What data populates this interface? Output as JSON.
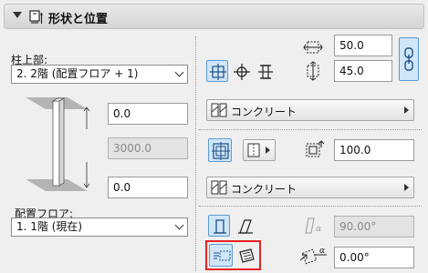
{
  "header": {
    "title": "形状と位置"
  },
  "left": {
    "top_label": "柱上部:",
    "top_select": "2. 2階 (配置フロア + 1)",
    "top_offset": "0.0",
    "height": "3000.0",
    "bottom_offset": "0.0",
    "bottom_label": "配置フロア:",
    "bottom_select": "1. 1階 (現在)"
  },
  "right": {
    "width_x": "50.0",
    "width_y": "45.0",
    "material_1": "コンクリート",
    "veneer_thickness": "100.0",
    "material_2": "コンクリート",
    "slant_angle": "90.00°",
    "rotation_angle": "0.00°"
  }
}
